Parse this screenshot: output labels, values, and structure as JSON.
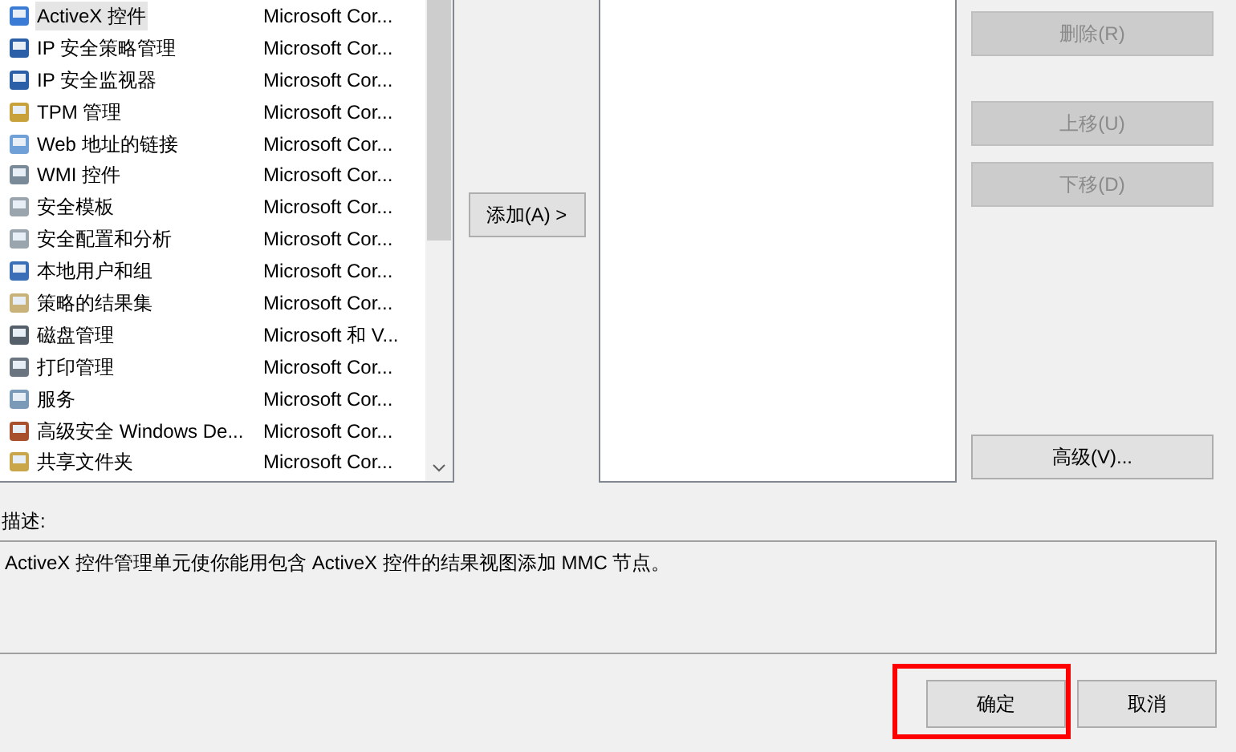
{
  "snapins": [
    {
      "name": "ActiveX 控件",
      "vendor": "Microsoft Cor...",
      "selected": true
    },
    {
      "name": "IP 安全策略管理",
      "vendor": "Microsoft Cor...",
      "selected": false
    },
    {
      "name": "IP 安全监视器",
      "vendor": "Microsoft Cor...",
      "selected": false
    },
    {
      "name": "TPM 管理",
      "vendor": "Microsoft Cor...",
      "selected": false
    },
    {
      "name": "Web 地址的链接",
      "vendor": "Microsoft Cor...",
      "selected": false
    },
    {
      "name": "WMI 控件",
      "vendor": "Microsoft Cor...",
      "selected": false
    },
    {
      "name": "安全模板",
      "vendor": "Microsoft Cor...",
      "selected": false
    },
    {
      "name": "安全配置和分析",
      "vendor": "Microsoft Cor...",
      "selected": false
    },
    {
      "name": "本地用户和组",
      "vendor": "Microsoft Cor...",
      "selected": false
    },
    {
      "name": "策略的结果集",
      "vendor": "Microsoft Cor...",
      "selected": false
    },
    {
      "name": "磁盘管理",
      "vendor": "Microsoft 和 V...",
      "selected": false
    },
    {
      "name": "打印管理",
      "vendor": "Microsoft Cor...",
      "selected": false
    },
    {
      "name": "服务",
      "vendor": "Microsoft Cor...",
      "selected": false
    },
    {
      "name": "高级安全 Windows De...",
      "vendor": "Microsoft Cor...",
      "selected": false
    },
    {
      "name": "共享文件夹",
      "vendor": "Microsoft Cor...",
      "selected": false
    }
  ],
  "add_button": "添加(A) >",
  "side_buttons": [
    {
      "label": "删除(R)",
      "disabled": true
    },
    {
      "label": "上移(U)",
      "disabled": true
    },
    {
      "label": "下移(D)",
      "disabled": true
    },
    {
      "label": "高级(V)...",
      "disabled": false
    }
  ],
  "description": {
    "label": "描述:",
    "text": "ActiveX 控件管理单元使你能用包含 ActiveX 控件的结果视图添加 MMC 节点。"
  },
  "footer_buttons": [
    {
      "label": "确定",
      "highlighted": true
    },
    {
      "label": "取消",
      "highlighted": false
    }
  ]
}
